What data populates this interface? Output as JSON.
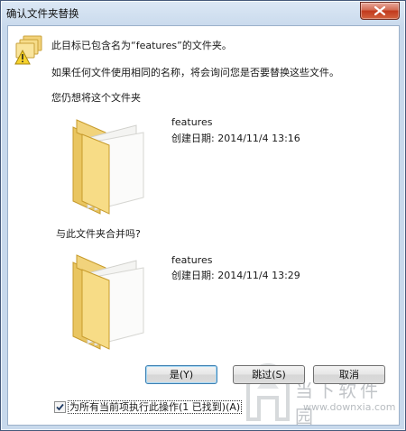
{
  "window": {
    "title": "确认文件夹替换",
    "close_icon": "close-icon"
  },
  "message": {
    "line1": "此目标已包含名为“features”的文件夹。",
    "line2": "如果任何文件使用相同的名称，将会询问您是否要替换这些文件。",
    "line3": "您仍想将这个文件夹"
  },
  "source_folder": {
    "name": "features",
    "created": "创建日期: 2014/11/4 13:16"
  },
  "merge_prompt": "与此文件夹合并吗?",
  "target_folder": {
    "name": "features",
    "created": "创建日期: 2014/11/4 13:29"
  },
  "buttons": {
    "yes": "是(Y)",
    "skip": "跳过(S)",
    "cancel": "取消"
  },
  "apply_all": {
    "label": "为所有当前项执行此操作(1 已找到)(A)",
    "checked": true
  },
  "watermark": {
    "brand": "当下软件园",
    "url": "www.downxia.com"
  },
  "colors": {
    "accent": "#3c7fb1",
    "close": "#c1391c",
    "folder": "#f4d77a"
  }
}
